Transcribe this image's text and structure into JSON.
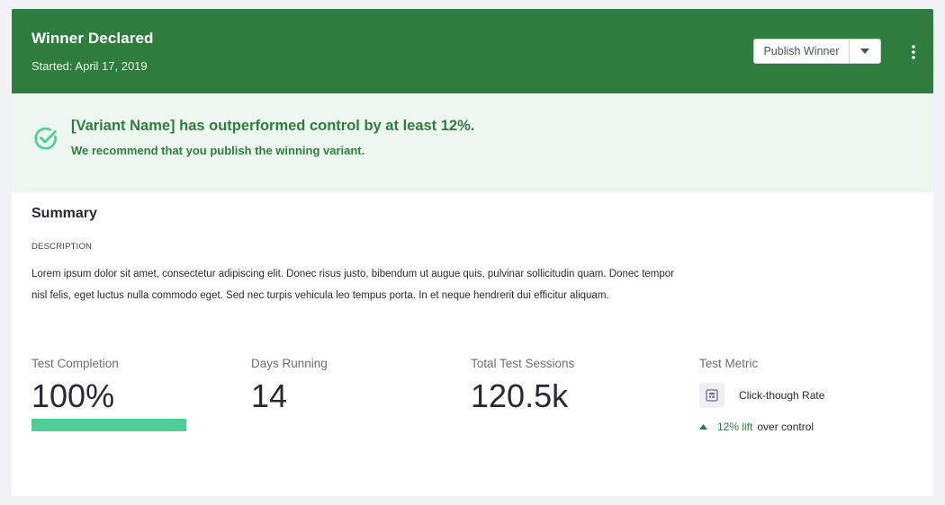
{
  "header": {
    "title": "Winner Declared",
    "subtitle": "Started: April 17, 2019",
    "publish_label": "Publish Winner",
    "background_color": "#2e7d3e"
  },
  "banner": {
    "title": "[Variant Name] has outperformed control by at least 12%.",
    "subtitle": "We recommend that you publish the winning variant.",
    "icon": "check-circle-icon",
    "accent_color": "#2e7d3e"
  },
  "summary": {
    "title": "Summary",
    "description_label": "DESCRIPTION",
    "description": "Lorem ipsum dolor sit amet, consectetur adipiscing elit. Donec risus justo, bibendum ut augue quis, pulvinar sollicitudin quam. Donec tempor nisl felis, eget luctus nulla commodo eget. Sed nec turpis vehicula leo tempus porta. In et neque hendrerit dui efficitur aliquam."
  },
  "metrics": {
    "completion": {
      "label": "Test Completion",
      "value": "100%",
      "progress": 1.0,
      "progress_color": "#4fcc97"
    },
    "days": {
      "label": "Days Running",
      "value": "14"
    },
    "sessions": {
      "label": "Total Test Sessions",
      "value": "120.5k"
    },
    "test_metric": {
      "label": "Test Metric",
      "name": "Click-though Rate",
      "icon": "metric-icon",
      "lift": "12% lift",
      "lift_suffix": "over control",
      "lift_icon": "caret-up-icon"
    }
  }
}
